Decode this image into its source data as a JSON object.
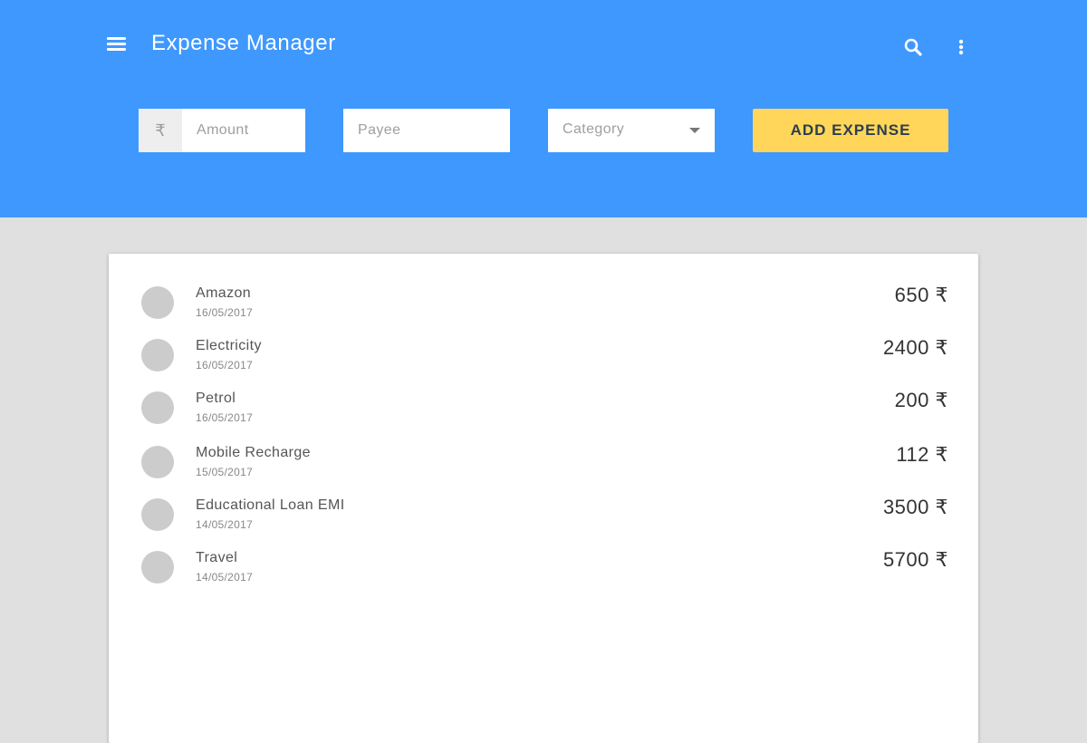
{
  "app": {
    "title": "Expense Manager",
    "header_color": "#3f98fe",
    "accent_color": "#ffd659"
  },
  "toolbar": {
    "menu_icon": "menu-icon",
    "search_icon": "search-icon",
    "more_icon": "more-vert-icon"
  },
  "form": {
    "currency_symbol": "₹",
    "amount_placeholder": "Amount",
    "payee_placeholder": "Payee",
    "category_placeholder": "Category",
    "add_button_label": "ADD EXPENSE"
  },
  "expenses": [
    {
      "payee": "Amazon",
      "date": "16/05/2017",
      "amount": "650 ₹"
    },
    {
      "payee": "Electricity",
      "date": "16/05/2017",
      "amount": "2400 ₹"
    },
    {
      "payee": "Petrol",
      "date": "16/05/2017",
      "amount": "200 ₹"
    },
    {
      "payee": "Mobile Recharge",
      "date": "15/05/2017",
      "amount": "112 ₹"
    },
    {
      "payee": "Educational Loan EMI",
      "date": "14/05/2017",
      "amount": "3500 ₹"
    },
    {
      "payee": "Travel",
      "date": "14/05/2017",
      "amount": "5700 ₹"
    }
  ]
}
